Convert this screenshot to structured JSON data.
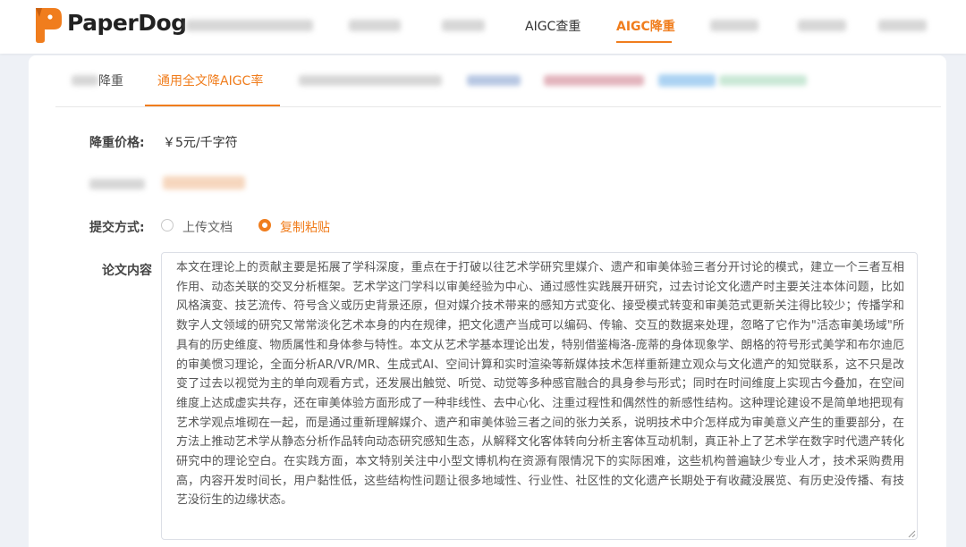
{
  "brand": {
    "name": "PaperDog",
    "logo_color": "#f07d1d"
  },
  "nav": {
    "items": [
      {
        "label": "AIGC查重",
        "active": false
      },
      {
        "label": "AIGC降重",
        "active": true
      }
    ],
    "accent": "#f07d1d"
  },
  "tabs": [
    {
      "label": "降重",
      "active": false
    },
    {
      "label": "通用全文降AIGC率",
      "active": true
    }
  ],
  "form": {
    "price_label": "降重价格:",
    "price_value": "￥5元/千字符",
    "submit_label": "提交方式:",
    "options": [
      {
        "label": "上传文档",
        "checked": false
      },
      {
        "label": "复制粘贴",
        "checked": true
      }
    ],
    "content_label": "论文内容",
    "content_text": "本文在理论上的贡献主要是拓展了学科深度，重点在于打破以往艺术学研究里媒介、遗产和审美体验三者分开讨论的模式，建立一个三者互相作用、动态关联的交叉分析框架。艺术学这门学科以审美经验为中心、通过感性实践展开研究，过去讨论文化遗产时主要关注本体问题，比如风格演变、技艺流传、符号含义或历史背景还原，但对媒介技术带来的感知方式变化、接受模式转变和审美范式更新关注得比较少；传播学和数字人文领域的研究又常常淡化艺术本身的内在规律，把文化遗产当成可以编码、传输、交互的数据来处理，忽略了它作为\"活态审美场域\"所具有的历史维度、物质属性和身体参与特性。本文从艺术学基本理论出发，特别借鉴梅洛-庞蒂的身体现象学、朗格的符号形式美学和布尔迪厄的审美惯习理论，全面分析AR/VR/MR、生成式AI、空间计算和实时渲染等新媒体技术怎样重新建立观众与文化遗产的知觉联系，这不只是改变了过去以视觉为主的单向观看方式，还发展出触觉、听觉、动觉等多种感官融合的具身参与形式；同时在时间维度上实现古今叠加，在空间维度上达成虚实共存，还在审美体验方面形成了一种非线性、去中心化、注重过程性和偶然性的新感性结构。这种理论建设不是简单地把现有艺术学观点堆砌在一起，而是通过重新理解媒介、遗产和审美体验三者之间的张力关系，说明技术中介怎样成为审美意义产生的重要部分，在方法上推动艺术学从静态分析作品转向动态研究感知生态，从解释文化客体转向分析主客体互动机制，真正补上了艺术学在数字时代遗产转化研究中的理论空白。在实践方面，本文特别关注中小型文博机构在资源有限情况下的实际困难，这些机构普遍缺少专业人才，技术采购费用高，内容开发时间长，用户黏性低，这些结构性问题让很多地域性、行业性、社区性的文化遗产长期处于有收藏没展览、有历史没传播、有技艺没衍生的边缘状态。"
  }
}
